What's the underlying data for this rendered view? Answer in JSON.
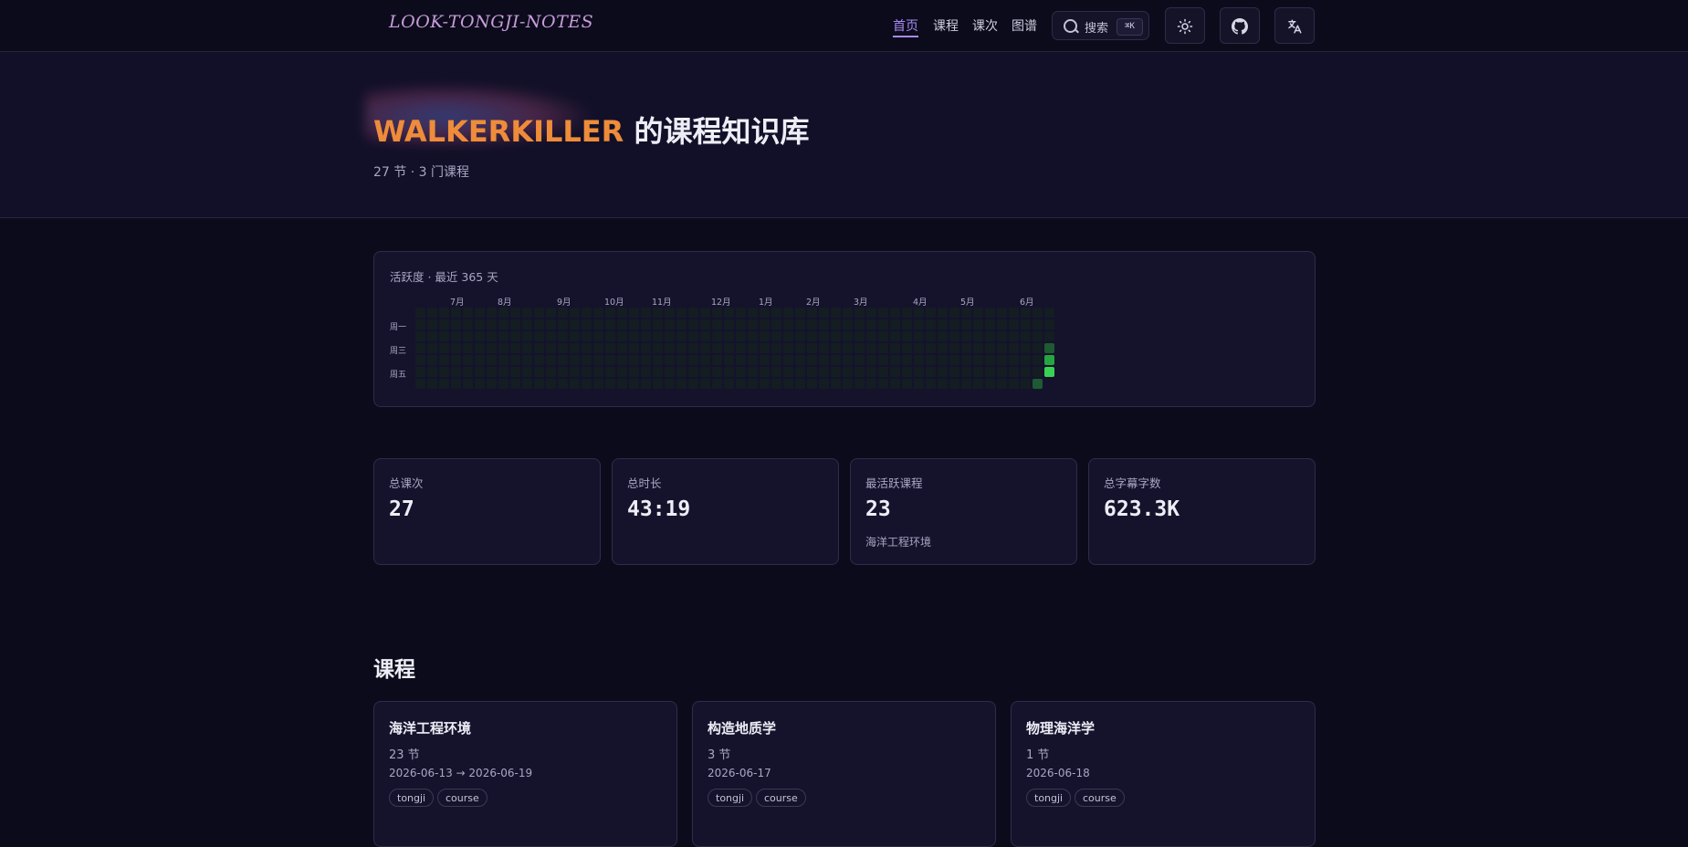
{
  "header": {
    "logo": "LOOK-TONGJI-NOTES",
    "nav": [
      "首页",
      "课程",
      "课次",
      "图谱"
    ],
    "search_label": "搜索",
    "search_shortcut": "⌘K",
    "icons": [
      "sun-icon",
      "github-icon",
      "translate-icon"
    ]
  },
  "hero": {
    "name": "WALKERKILLER",
    "title_suffix": "的课程知识库",
    "subtitle": "27 节 · 3 门课程"
  },
  "activity": {
    "title": "活跃度 · 最近 365 天",
    "months": [
      "7月",
      "8月",
      "9月",
      "10月",
      "11月",
      "12月",
      "1月",
      "2月",
      "3月",
      "4月",
      "5月",
      "6月"
    ],
    "day_labels": [
      "周一",
      "周三",
      "周五"
    ],
    "active_days": [
      {
        "week": 52,
        "day": 6,
        "level": 2
      },
      {
        "week": 53,
        "day": 3,
        "level": 2
      },
      {
        "week": 53,
        "day": 4,
        "level": 3
      },
      {
        "week": 53,
        "day": 5,
        "level": 4
      }
    ],
    "colors": {
      "empty": "#141d22",
      "level1": "#0e4429",
      "level2": "#1e5a32",
      "level3": "#26a641",
      "level4": "#39d353"
    }
  },
  "stats": [
    {
      "label": "总课次",
      "value": "27",
      "sub": ""
    },
    {
      "label": "总时长",
      "value": "43:19",
      "sub": ""
    },
    {
      "label": "最活跃课程",
      "value": "23",
      "sub": "海洋工程环境"
    },
    {
      "label": "总字幕字数",
      "value": "623.3K",
      "sub": ""
    }
  ],
  "courses_section": {
    "title": "课程",
    "courses": [
      {
        "title": "海洋工程环境",
        "count": "23 节",
        "date": "2026-06-13 → 2026-06-19",
        "tags": [
          "tongji",
          "course"
        ]
      },
      {
        "title": "构造地质学",
        "count": "3 节",
        "date": "2026-06-17",
        "tags": [
          "tongji",
          "course"
        ]
      },
      {
        "title": "物理海洋学",
        "count": "1 节",
        "date": "2026-06-18",
        "tags": [
          "tongji",
          "course"
        ]
      }
    ]
  }
}
